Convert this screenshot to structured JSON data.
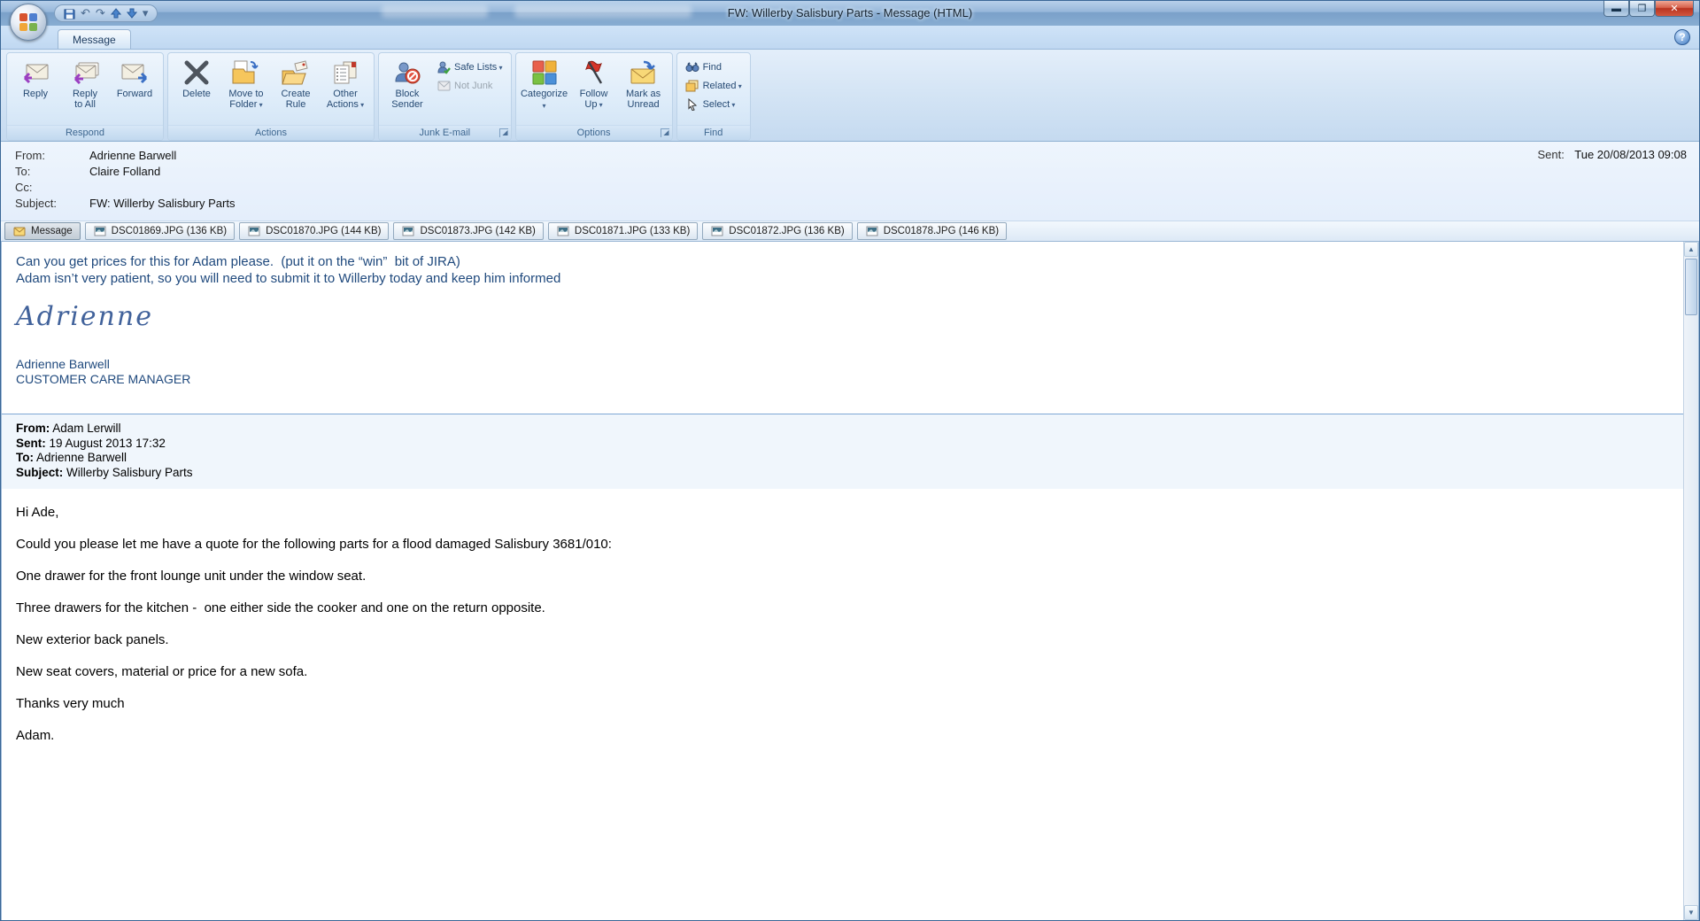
{
  "window": {
    "title": "FW: Willerby Salisbury Parts - Message (HTML)"
  },
  "tabs": {
    "message": "Message"
  },
  "ribbon": {
    "respond": {
      "label": "Respond",
      "reply": "Reply",
      "reply_to_all": "Reply\nto All",
      "forward": "Forward"
    },
    "actions": {
      "label": "Actions",
      "delete": "Delete",
      "move_to_folder": "Move to\nFolder",
      "create_rule": "Create\nRule",
      "other_actions": "Other\nActions"
    },
    "junk": {
      "label": "Junk E-mail",
      "block_sender": "Block\nSender",
      "safe_lists": "Safe Lists",
      "not_junk": "Not Junk"
    },
    "options": {
      "label": "Options",
      "categorize": "Categorize",
      "follow_up": "Follow\nUp",
      "mark_as_unread": "Mark as\nUnread"
    },
    "find": {
      "label": "Find",
      "find": "Find",
      "related": "Related",
      "select": "Select"
    }
  },
  "header": {
    "from_label": "From:",
    "from": "Adrienne Barwell",
    "to_label": "To:",
    "to": "Claire Folland",
    "cc_label": "Cc:",
    "cc": "",
    "subject_label": "Subject:",
    "subject": "FW: Willerby Salisbury Parts",
    "sent_label": "Sent:",
    "sent": "Tue 20/08/2013 09:08"
  },
  "attachments": {
    "message_tab": "Message",
    "files": [
      {
        "name": "DSC01869.JPG (136 KB)"
      },
      {
        "name": "DSC01870.JPG (144 KB)"
      },
      {
        "name": "DSC01873.JPG (142 KB)"
      },
      {
        "name": "DSC01871.JPG (133 KB)"
      },
      {
        "name": "DSC01872.JPG (136 KB)"
      },
      {
        "name": "DSC01878.JPG (146 KB)"
      }
    ]
  },
  "body": {
    "intro_line1": "Can you get prices for this for Adam please.  (put it on the “win”  bit of JIRA)",
    "intro_line2": "Adam isn’t very patient, so you will need to submit it to Willerby today and keep him informed",
    "signature_script": "Adrienne",
    "signature_name": "Adrienne Barwell",
    "signature_title": "CUSTOMER CARE MANAGER",
    "quoted": {
      "from_label": "From:",
      "from": " Adam Lerwill",
      "sent_label": "Sent:",
      "sent": " 19 August 2013 17:32",
      "to_label": "To:",
      "to": " Adrienne Barwell",
      "subject_label": "Subject:",
      "subject": " Willerby Salisbury Parts"
    },
    "paragraphs": [
      "Hi Ade,",
      "Could you please let me have a quote for the following parts for a flood damaged Salisbury 3681/010:",
      "One drawer for the front lounge unit under the window seat.",
      "Three drawers for the kitchen -  one either side the cooker and one on the return opposite.",
      "New exterior back panels.",
      "New seat covers, material or price for a new sofa.",
      "Thanks very much",
      "Adam."
    ]
  },
  "colors": {
    "email_blue_text": "#1F497D",
    "titlebar_blue": "#88add2",
    "close_red": "#b93420",
    "categorize_red": "#e8604c",
    "categorize_yellow": "#f0b23a",
    "categorize_green": "#7ac143",
    "categorize_blue": "#4a90d9"
  }
}
